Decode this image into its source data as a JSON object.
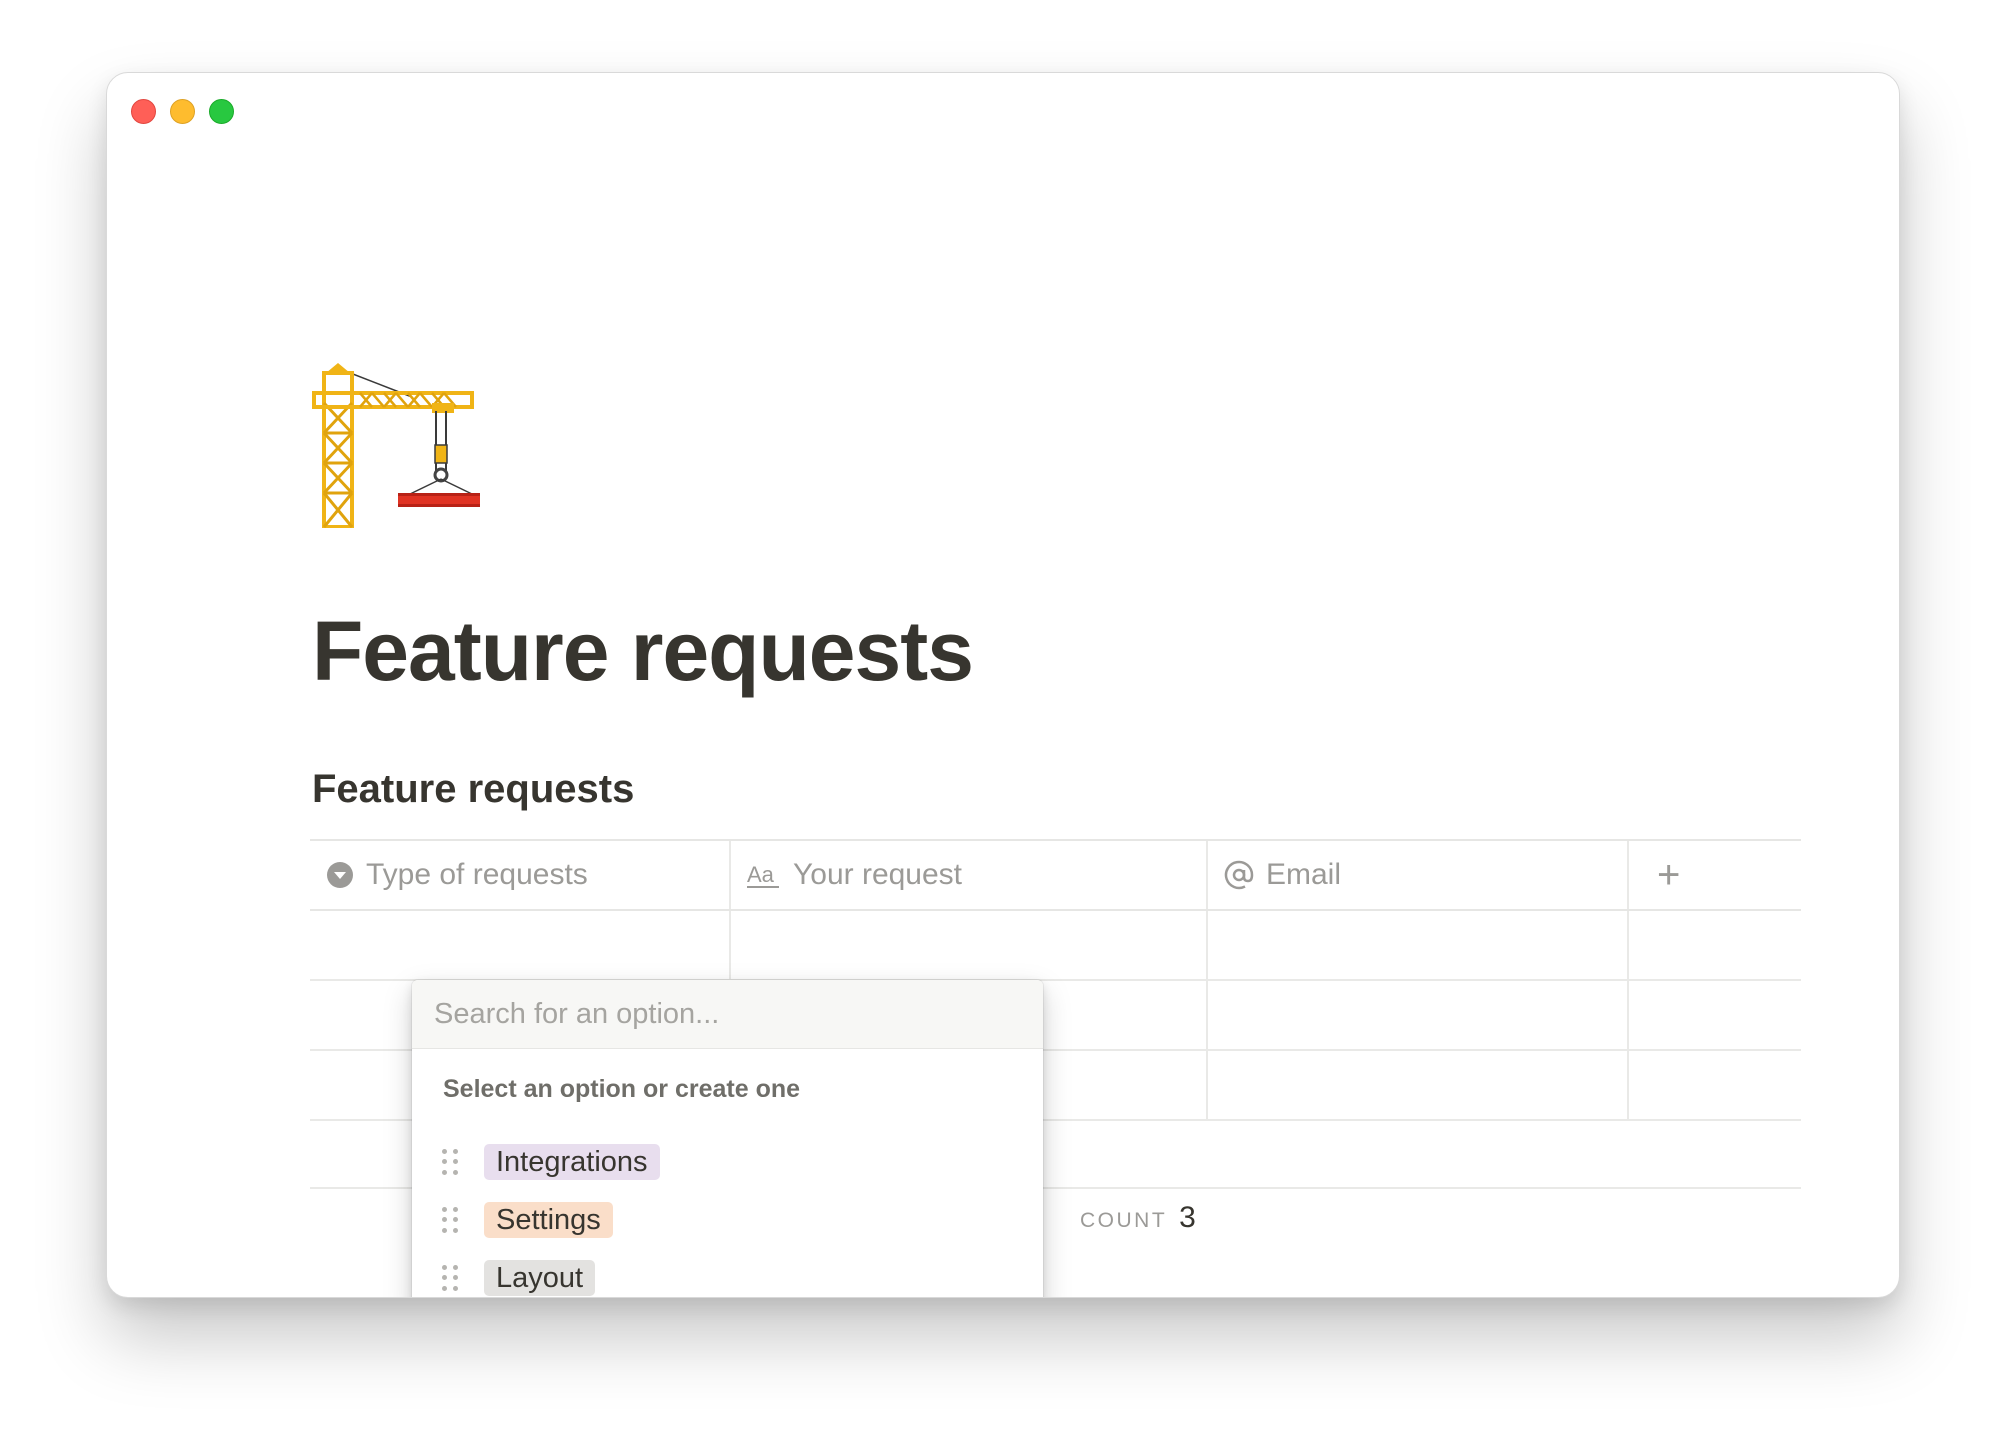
{
  "page": {
    "icon": "construction-crane-icon",
    "title": "Feature requests"
  },
  "database": {
    "title": "Feature requests",
    "columns": [
      {
        "label": "Type of requests",
        "icon": "select-chevron-icon"
      },
      {
        "label": "Your request",
        "icon": "text-aa-icon"
      },
      {
        "label": "Email",
        "icon": "at-sign-icon"
      }
    ],
    "add_column_label": "+",
    "rows": [
      {},
      {},
      {}
    ],
    "count_label": "COUNT",
    "count_value": "3"
  },
  "dropdown": {
    "search_placeholder": "Search for an option...",
    "hint": "Select an option or create one",
    "options": [
      {
        "label": "Integrations",
        "color": "#e8deee"
      },
      {
        "label": "Settings",
        "color": "#fadec9"
      },
      {
        "label": "Layout",
        "color": "#e3e2e0"
      }
    ]
  },
  "colors": {
    "text": "#37352f",
    "muted": "#9b9a97"
  }
}
